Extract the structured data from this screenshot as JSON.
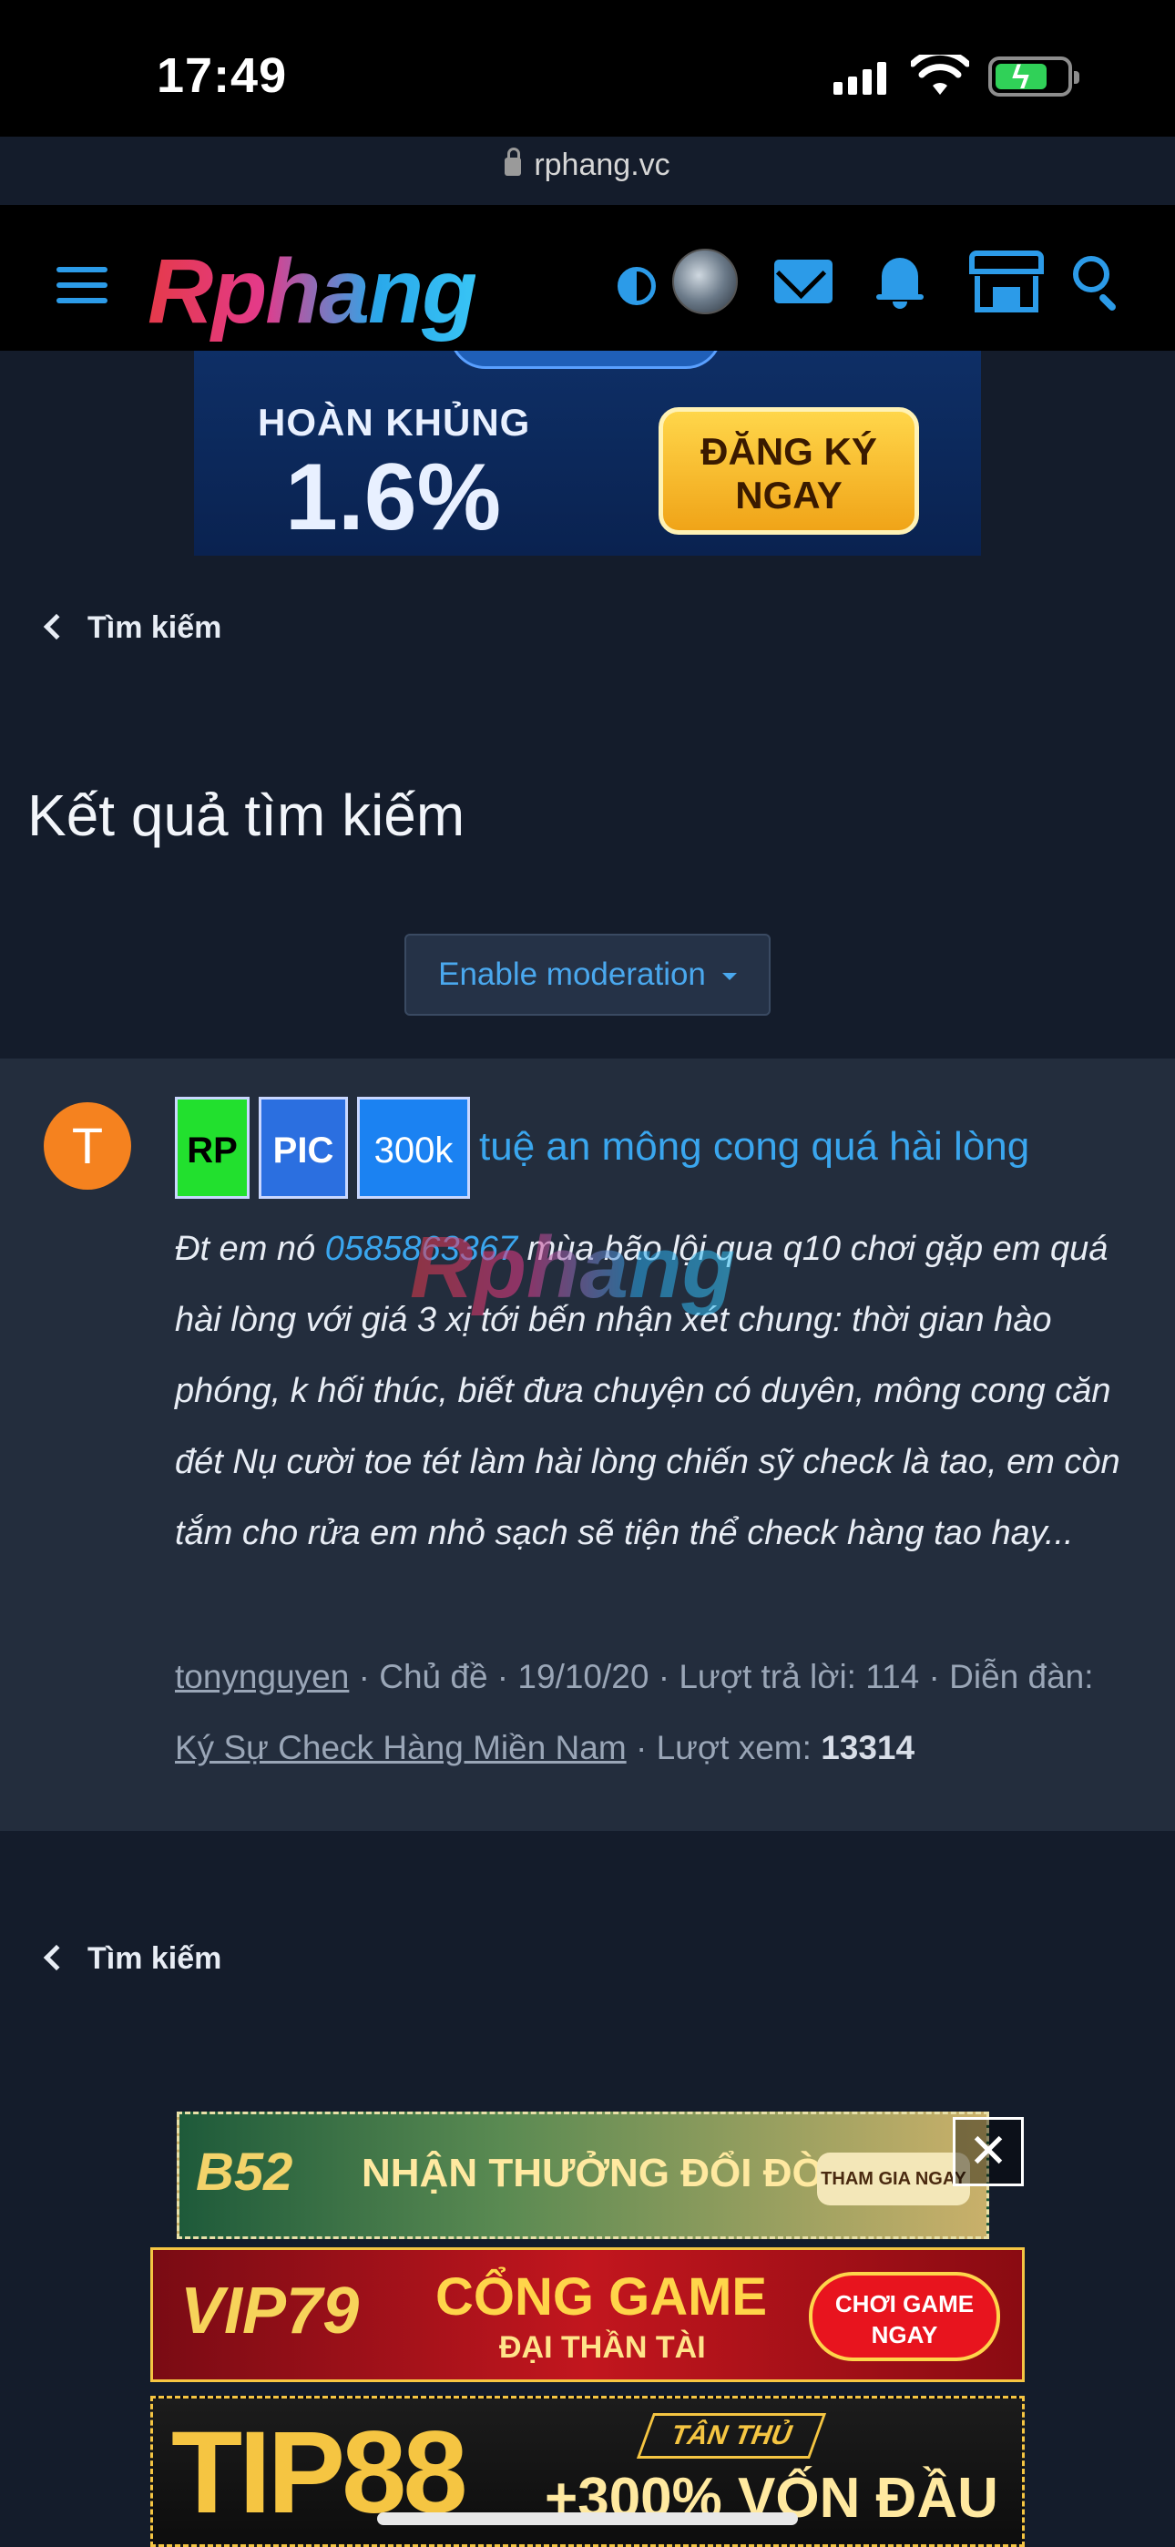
{
  "status_bar": {
    "time": "17:49",
    "url": "rphang.vc"
  },
  "header": {
    "logo": "Rphang"
  },
  "top_banner": {
    "line1": "HOÀN KHỦNG",
    "line2": "1.6%",
    "button": "ĐĂNG KÝ NGAY"
  },
  "nav": {
    "back_top": "Tìm kiếm",
    "back_bottom": "Tìm kiếm"
  },
  "page": {
    "title": "Kết quả tìm kiếm",
    "moderation_button": "Enable moderation"
  },
  "result": {
    "avatar_letter": "T",
    "tags": [
      "RP",
      "PIC",
      "300k"
    ],
    "title": "tuệ an mông cong quá hài lòng",
    "snippet_before": "Đt em nó ",
    "snippet_phone": "0585863367",
    "snippet_after": " mùa bão lội qua q10 chơi gặp em quá hài lòng với giá 3 xị tới bến nhận xét chung: thời gian hào phóng, k hối thúc, biết đưa chuyện có duyên, mông cong căn đét Nụ cười toe tét làm hài lòng chiến sỹ check là tao, em còn tắm cho rửa em nhỏ sạch sẽ tiện thể check hàng tao hay...",
    "watermark": "Rphang",
    "author": "tonynguyen",
    "type": "Chủ đề",
    "date": "19/10/20",
    "replies_label": "Lượt trả lời:",
    "replies": "114",
    "forum_label": "Diễn đàn:",
    "forum": "Ký Sự Check Hàng Miền Nam",
    "views_label": "Lượt xem:",
    "views": "13314"
  },
  "ads": {
    "ad1_logo": "B52",
    "ad1_text": "NHẬN THƯỞNG ĐỔI ĐỜI",
    "ad1_button": "THAM GIA NGAY",
    "close": "✕",
    "ad2_logo": "VIP79",
    "ad2_line1": "CỔNG GAME",
    "ad2_line2": "ĐẠI THẦN TÀI",
    "ad2_button": "CHƠI GAME NGAY",
    "ad3_logo": "TIP88",
    "ad3_badge": "TÂN THỦ",
    "ad3_text": "+300% VỐN ĐẦU"
  },
  "colors": {
    "accent": "#2c9be8",
    "background": "#141c2b",
    "card": "#232d3d",
    "avatar": "#f5821f"
  }
}
